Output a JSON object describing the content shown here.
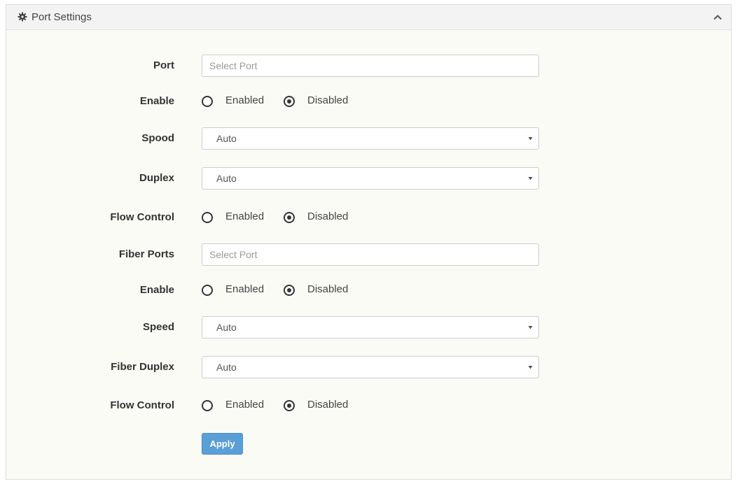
{
  "panel": {
    "title": "Port Settings",
    "icon": "gear-icon",
    "collapse_icon": "chevron-up-icon"
  },
  "form": {
    "port": {
      "label": "Port",
      "placeholder": "Select Port"
    },
    "enable": {
      "label": "Enable",
      "options": [
        "Enabled",
        "Disabled"
      ],
      "selected": "Disabled"
    },
    "speed": {
      "label": "Spood",
      "value": "Auto"
    },
    "duplex": {
      "label": "Duplex",
      "value": "Auto"
    },
    "flow_control": {
      "label": "Flow Control",
      "options": [
        "Enabled",
        "Disabled"
      ],
      "selected": "Disabled"
    },
    "fiber_ports": {
      "label": "Fiber Ports",
      "placeholder": "Select Port"
    },
    "fiber_enable": {
      "label": "Enable",
      "options": [
        "Enabled",
        "Disabled"
      ],
      "selected": "Disabled"
    },
    "fiber_speed": {
      "label": "Speed",
      "value": "Auto"
    },
    "fiber_duplex": {
      "label": "Fiber Duplex",
      "value": "Auto"
    },
    "fiber_flow_control": {
      "label": "Flow Control",
      "options": [
        "Enabled",
        "Disabled"
      ],
      "selected": "Disabled"
    }
  },
  "apply_label": "Apply",
  "colors": {
    "accent": "#5b9fd8",
    "panel_bg": "#fbfbf5",
    "header_bg": "#f3f3f3"
  }
}
